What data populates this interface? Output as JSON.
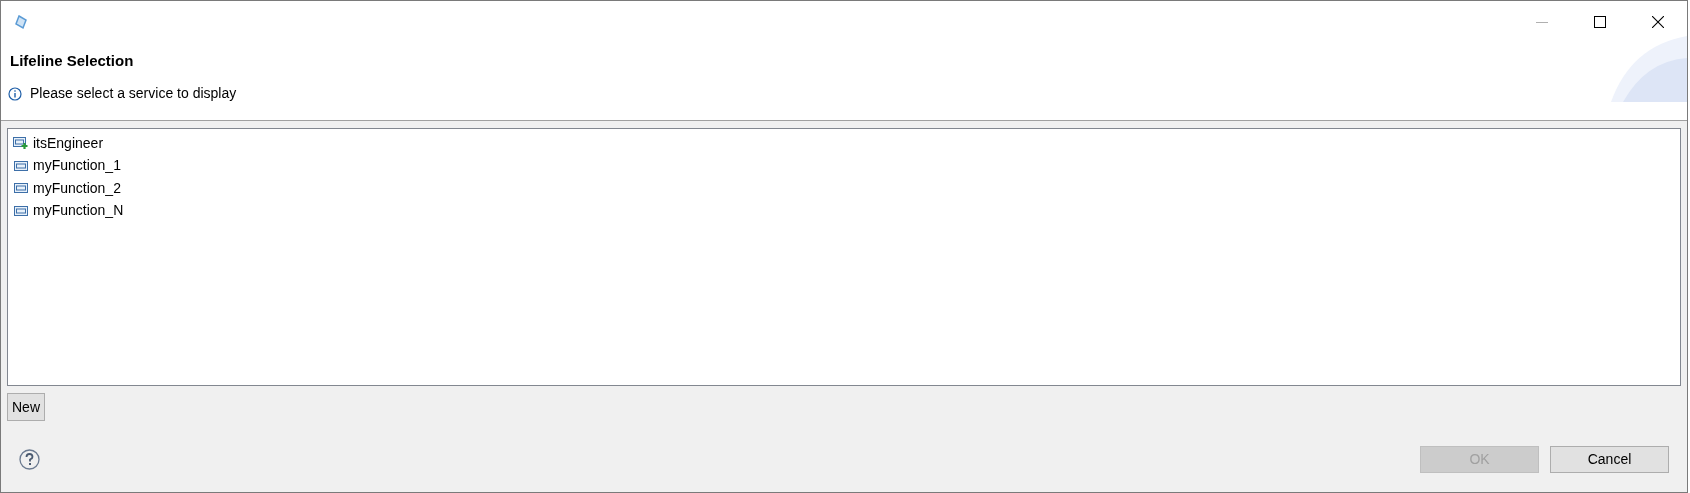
{
  "window": {
    "title_buttons": [
      {
        "kind": "minimize",
        "disabled": true
      },
      {
        "kind": "maximize",
        "disabled": false
      },
      {
        "kind": "close",
        "disabled": false
      }
    ]
  },
  "header": {
    "title": "Lifeline Selection",
    "message": "Please select a service to display"
  },
  "list": {
    "items": [
      {
        "label": "itsEngineer",
        "kind": "added"
      },
      {
        "label": "myFunction_1",
        "kind": "plain"
      },
      {
        "label": "myFunction_2",
        "kind": "plain"
      },
      {
        "label": "myFunction_N",
        "kind": "plain"
      }
    ]
  },
  "new_button": {
    "label": "New"
  },
  "buttons": [
    {
      "label": "OK",
      "disabled": true
    },
    {
      "label": "Cancel",
      "disabled": false
    }
  ]
}
